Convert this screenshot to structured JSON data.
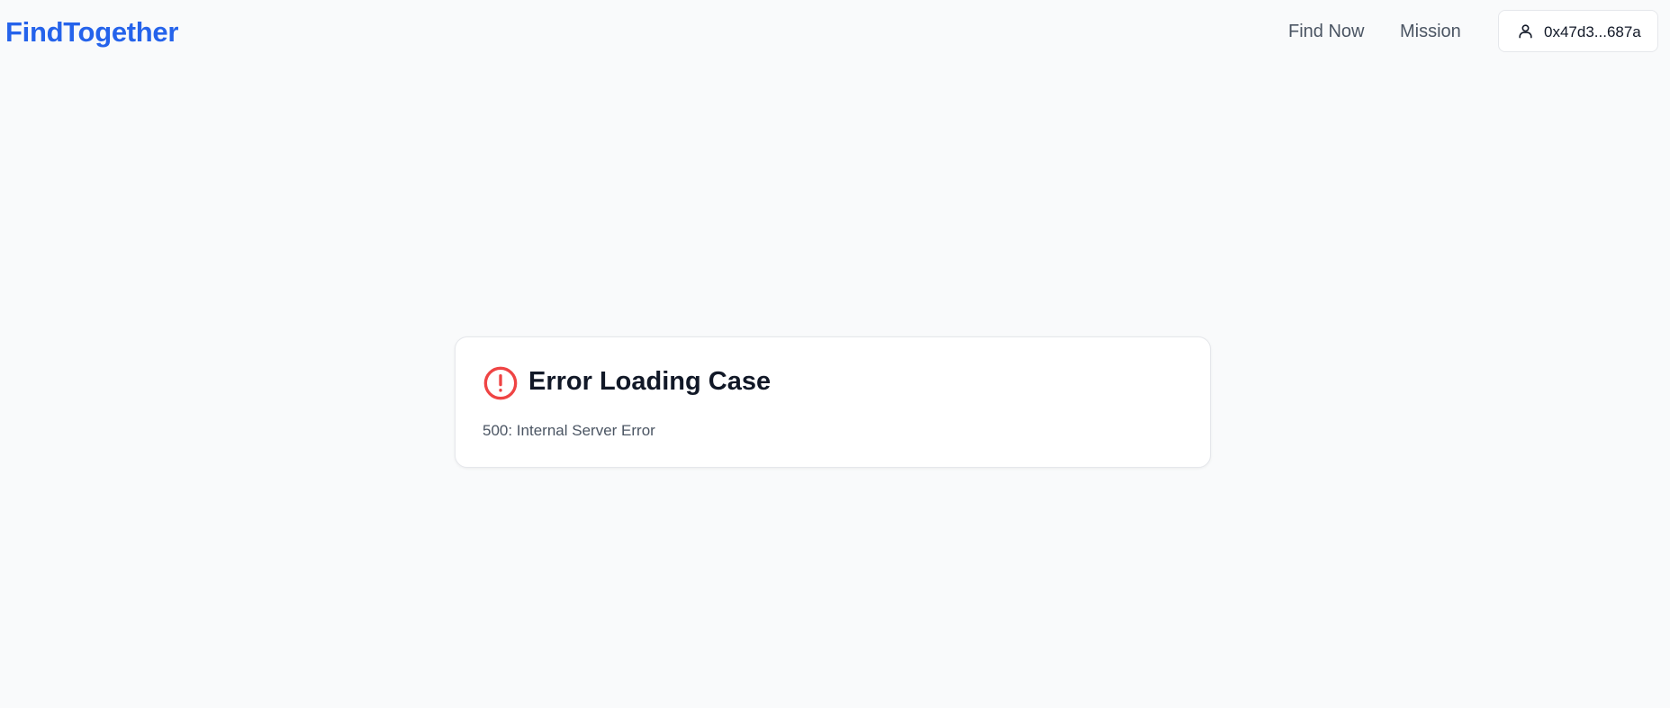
{
  "header": {
    "logo": "FindTogether",
    "nav": [
      {
        "label": "Find Now"
      },
      {
        "label": "Mission"
      }
    ],
    "wallet": {
      "address": "0x47d3...687a",
      "icon": "user-icon"
    }
  },
  "error_card": {
    "icon": "alert-circle-icon",
    "title": "Error Loading Case",
    "message": "500: Internal Server Error"
  },
  "colors": {
    "brand": "#2563eb",
    "error": "#ef4444",
    "background": "#f9fafb"
  }
}
